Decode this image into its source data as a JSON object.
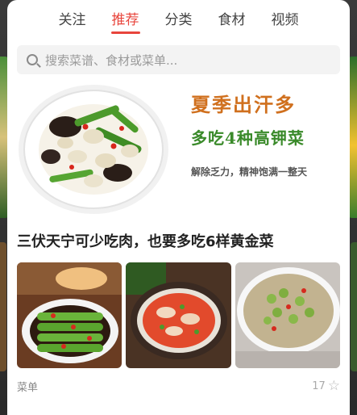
{
  "tabs": [
    {
      "label": "关注",
      "active": false
    },
    {
      "label": "推荐",
      "active": true
    },
    {
      "label": "分类",
      "active": false
    },
    {
      "label": "食材",
      "active": false
    },
    {
      "label": "视频",
      "active": false
    }
  ],
  "search": {
    "placeholder": "搜索菜谱、食材或菜单..."
  },
  "banner": {
    "title_line1": "夏季出汗多",
    "title_line2": "多吃4种高钾菜",
    "subtitle": "解除乏力，精神饱满一整天"
  },
  "article": {
    "title": "三伏天宁可少吃肉，也要多吃6样黄金菜",
    "category": "菜单",
    "likes": "17"
  },
  "colors": {
    "accent": "#e8453c"
  },
  "icons": {
    "search": "search-icon",
    "favorite": "star-outline-icon"
  }
}
